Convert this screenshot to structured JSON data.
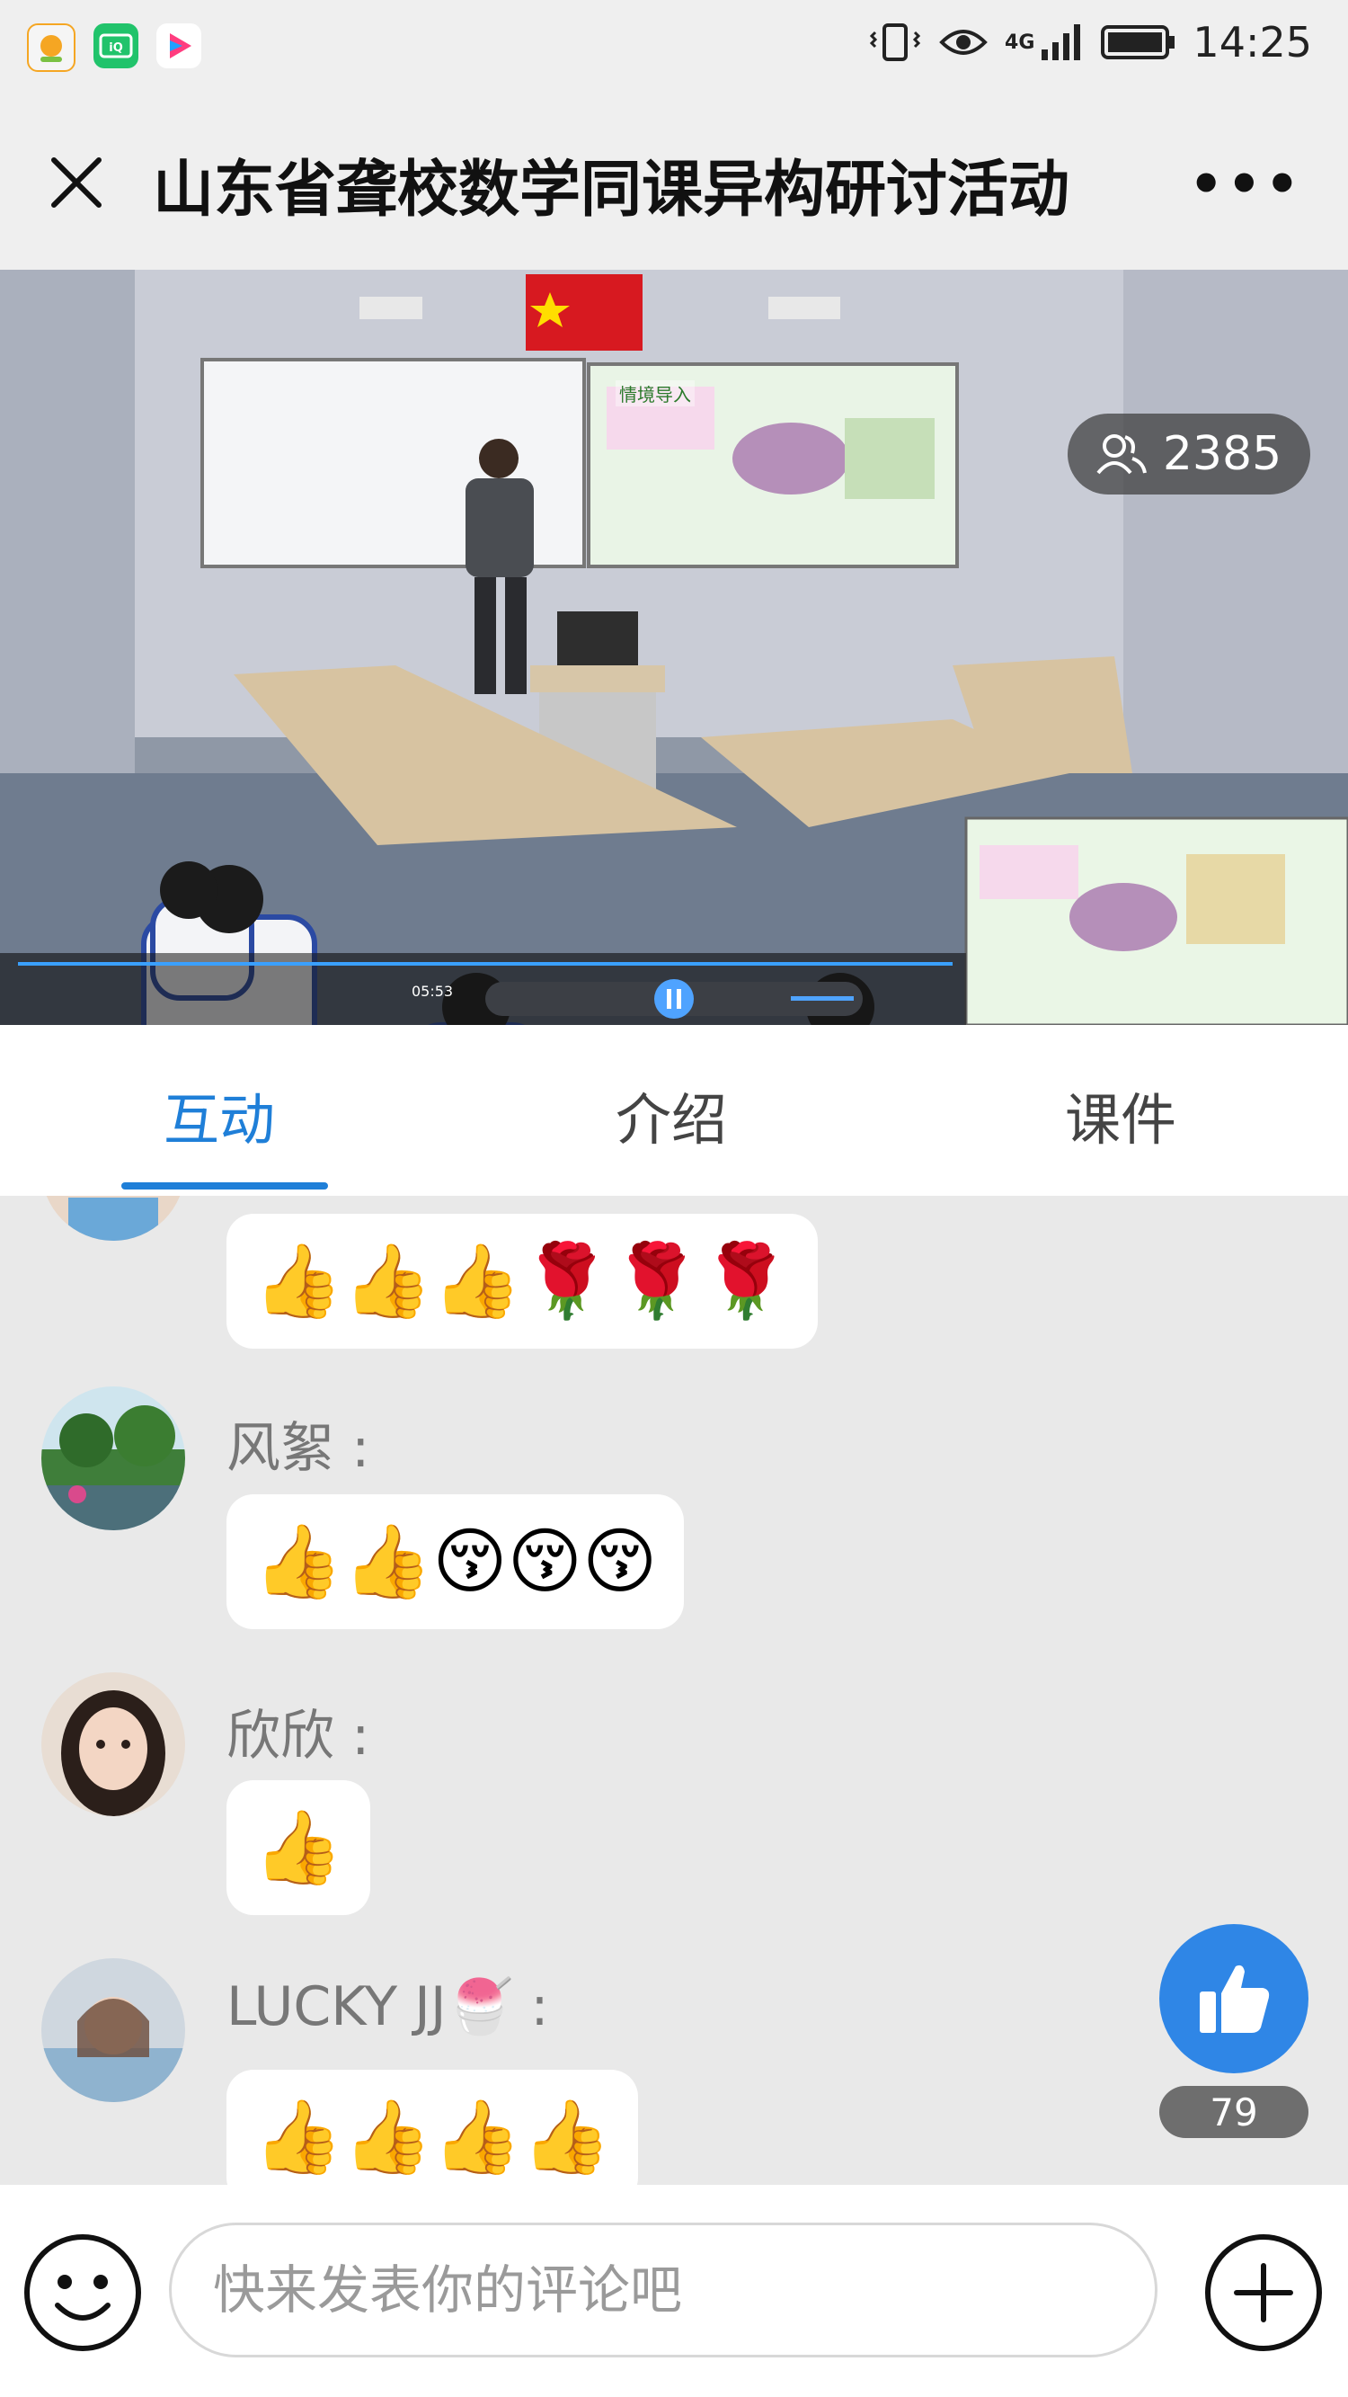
{
  "status_bar": {
    "apps": [
      {
        "name": "app-icon-1",
        "color": "#f5a623",
        "glyph": "◉"
      },
      {
        "name": "iqiyi-icon",
        "color": "#21c36b",
        "glyph": "iQIYI"
      },
      {
        "name": "youku-icon",
        "color": "#ff3d7f",
        "glyph": "▶"
      }
    ],
    "network": "4G",
    "time": "14:25"
  },
  "header": {
    "title": "山东省聋校数学同课异构研讨活动"
  },
  "video": {
    "viewer_count": "2385",
    "playback_time": "05:53",
    "slide_title": "情境导入",
    "flag_color": "#d71920"
  },
  "tabs": [
    {
      "label": "互动",
      "active": true
    },
    {
      "label": "介绍",
      "active": false
    },
    {
      "label": "课件",
      "active": false
    }
  ],
  "comments": [
    {
      "name": "",
      "emojis": "👍👍👍🌹🌹🌹"
    },
    {
      "name": "风絮 :",
      "emojis": "👍👍😚😚😚"
    },
    {
      "name": "欣欣 :",
      "emojis": "👍"
    },
    {
      "name": "LUCKY JJ🍧 :",
      "emojis": "👍👍👍👍"
    }
  ],
  "like": {
    "count": "79"
  },
  "composer": {
    "placeholder": "快来发表你的评论吧"
  },
  "colors": {
    "accent": "#1f7fd8",
    "like_button": "#2f86e6"
  }
}
